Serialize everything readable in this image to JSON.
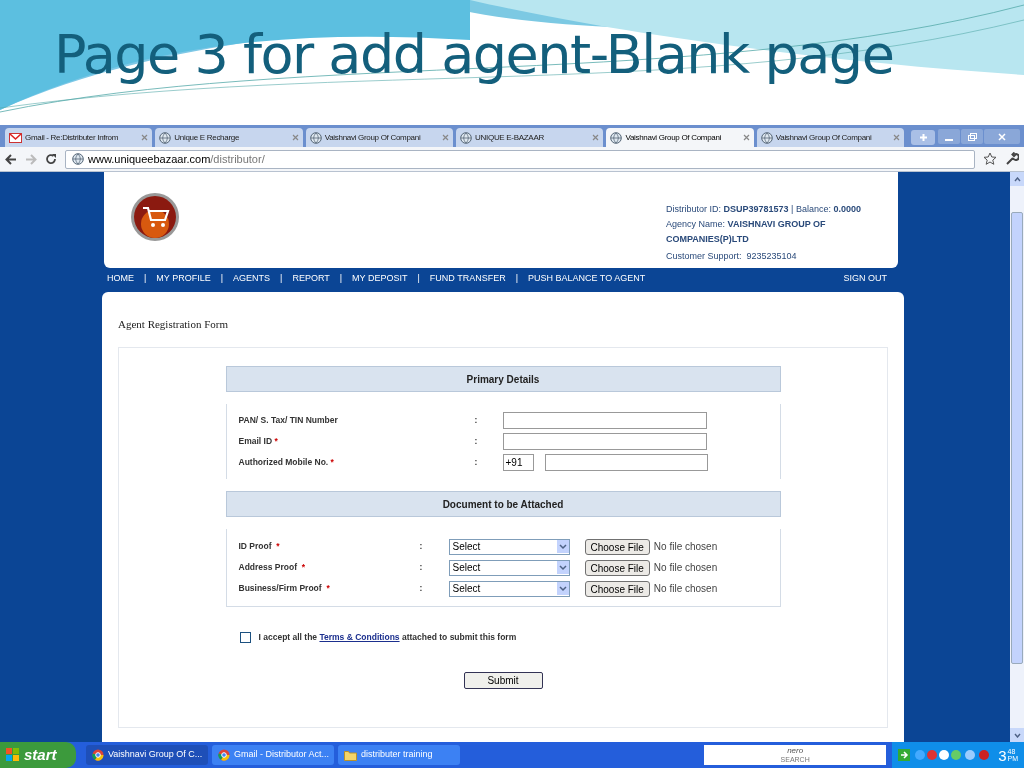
{
  "slide_title": "Page 3 for add agent-Blank page",
  "browser": {
    "tabs": [
      {
        "label": "Gmail - Re:Distributer Infrom",
        "kind": "mail",
        "selected": false
      },
      {
        "label": "Unique E Recharge",
        "kind": "globe",
        "selected": false
      },
      {
        "label": "Vaishnavi Group Of Compani",
        "kind": "globe",
        "selected": false
      },
      {
        "label": "UNIQUE E-BAZAAR",
        "kind": "globe",
        "selected": false
      },
      {
        "label": "Vaishnavi Group Of Compani",
        "kind": "globe",
        "selected": true
      },
      {
        "label": "Vaishnavi Group Of Compani",
        "kind": "globe",
        "selected": false
      }
    ],
    "url_host": "www.uniqueebazaar.com",
    "url_path": "/distributor/"
  },
  "header": {
    "distributor_id_label": "Distributor ID:",
    "distributor_id": "DSUP39781573",
    "balance_label": "| Balance:",
    "balance": "0.0000",
    "agency_label": "Agency Name:",
    "agency": "VAISHNAVI GROUP OF COMPANIES(P)LTD",
    "support_label": "Customer Support:",
    "support": "9235235104"
  },
  "nav": {
    "items": [
      "HOME",
      "MY PROFILE",
      "AGENTS",
      "REPORT",
      "MY DEPOSIT",
      "FUND TRANSFER",
      "PUSH BALANCE TO AGENT"
    ],
    "separator": "|",
    "sign_out": "SIGN OUT"
  },
  "form_title": "Agent Registration Form",
  "primary": {
    "heading": "Primary Details",
    "fields": [
      {
        "label": "PAN/ S. Tax/ TIN Number",
        "required": false,
        "kind": "text"
      },
      {
        "label": "Email ID",
        "required": true,
        "kind": "text"
      },
      {
        "label": "Authorized Mobile No.",
        "required": true,
        "kind": "phone",
        "prefix": "+91"
      }
    ]
  },
  "documents": {
    "heading": "Document to be Attached",
    "rows": [
      {
        "label": "ID Proof",
        "required": true,
        "select": "Select",
        "button": "Choose File",
        "status": "No file chosen"
      },
      {
        "label": "Address Proof",
        "required": true,
        "select": "Select",
        "button": "Choose File",
        "status": "No file chosen"
      },
      {
        "label": "Business/Firm Proof",
        "required": true,
        "select": "Select",
        "button": "Choose File",
        "status": "No file chosen"
      }
    ]
  },
  "colon": ":",
  "required_mark": "*",
  "terms": {
    "checked": false,
    "before": "I accept all the ",
    "link": "Terms & Conditions",
    "after": " attached to submit this form"
  },
  "submit": "Submit",
  "taskbar": {
    "start": "start",
    "items": [
      {
        "label": "Vaishnavi Group Of C...",
        "kind": "browser"
      },
      {
        "label": "Gmail - Distributor Act...",
        "kind": "browser"
      },
      {
        "label": "distributer training",
        "kind": "folder"
      }
    ],
    "search_logo": "nero",
    "search_sub": "SEARCH",
    "clock_hour": "3",
    "clock_min": "48",
    "clock_ampm": "PM"
  }
}
